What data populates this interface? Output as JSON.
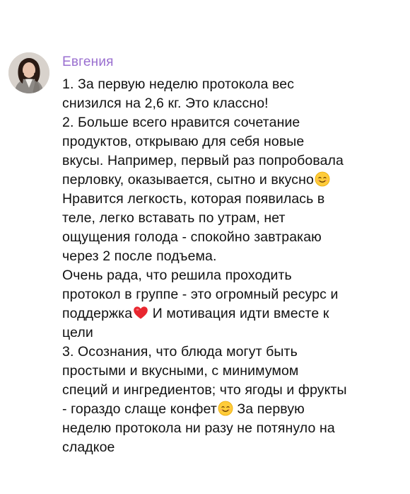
{
  "message": {
    "sender_name": "Евгения",
    "avatar_icon": "user-avatar-photo",
    "accent_color": "#9a6fd0",
    "lines": [
      "1. За первую неделю протокола вес",
      "снизился на 2,6 кг. Это классно!",
      "2. Больше всего нравится сочетание",
      "продуктов, открываю для себя новые",
      "вкусы. Например, первый раз попробовала",
      "перловку, оказывается, сытно и вкусно",
      "Нравится легкость, которая появилась в",
      "теле, легко вставать по утрам, нет",
      "ощущения голода - спокойно завтракаю",
      "через 2 после подъема.",
      "Очень рада, что решила проходить",
      "протокол в группе - это огромный ресурс и",
      "поддержка",
      "И мотивация идти вместе к",
      "цели",
      "3. Осознания, что блюда могут быть",
      "простыми и вкусными, с минимумом",
      "специй и ингредиентов; что ягоды и фрукты",
      "- гораздо слаще конфет",
      "За первую",
      "неделю протокола ни разу не потянуло на",
      "сладкое"
    ],
    "emojis": {
      "smile": "smiling-face-icon",
      "heart": "red-heart-icon"
    }
  }
}
